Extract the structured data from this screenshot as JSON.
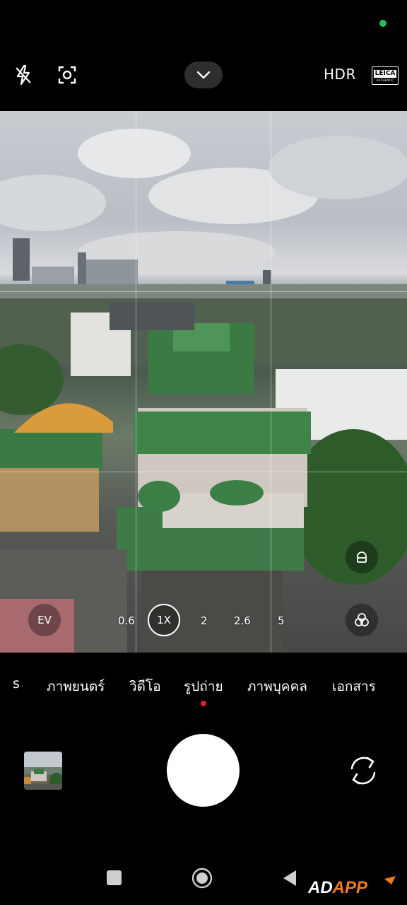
{
  "top_bar": {
    "flash_icon": "flash-off-icon",
    "focus_icon": "focus-lens-icon",
    "more_icon": "chevron-down-icon",
    "hdr_label": "HDR",
    "leica_label_top": "LEICA",
    "leica_label_bottom": "AUTHENTIC"
  },
  "status": {
    "indicator_color": "#20c05c"
  },
  "viewfinder": {
    "ev_label": "EV",
    "zoom_levels": [
      "0.6",
      "1X",
      "2",
      "2.6",
      "5"
    ],
    "zoom_selected": "1X",
    "side_icons": [
      "lens-mode-icon",
      "filter-icon"
    ]
  },
  "modes": {
    "items": [
      "s",
      "ภาพยนตร์",
      "วิดีโอ",
      "รูปถ่าย",
      "ภาพบุคคล",
      "เอกสาร"
    ],
    "active": "รูปถ่าย",
    "active_dot_color": "#e0202a"
  },
  "controls": {
    "gallery_icon": "gallery-thumbnail",
    "shutter_icon": "shutter-button",
    "switch_icon": "switch-camera-icon"
  },
  "nav": {
    "icons": [
      "recents-icon",
      "home-icon",
      "back-icon"
    ]
  },
  "watermark": {
    "text": "ADAPP"
  }
}
